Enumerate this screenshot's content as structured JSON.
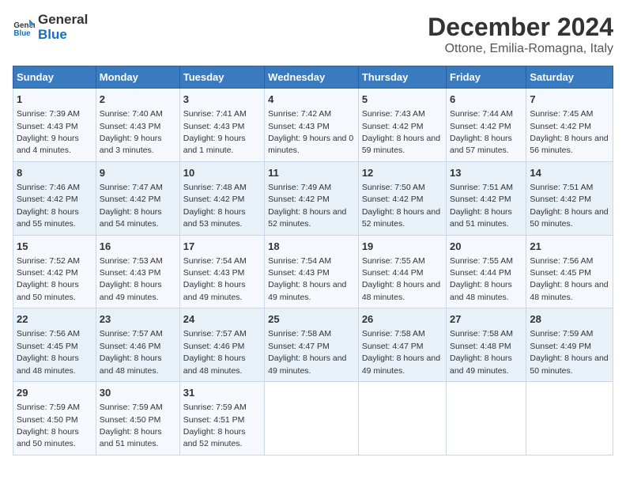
{
  "logo": {
    "text_general": "General",
    "text_blue": "Blue"
  },
  "title": "December 2024",
  "subtitle": "Ottone, Emilia-Romagna, Italy",
  "days_of_week": [
    "Sunday",
    "Monday",
    "Tuesday",
    "Wednesday",
    "Thursday",
    "Friday",
    "Saturday"
  ],
  "weeks": [
    [
      {
        "day": "1",
        "sunrise": "7:39 AM",
        "sunset": "4:43 PM",
        "daylight": "9 hours and 4 minutes."
      },
      {
        "day": "2",
        "sunrise": "7:40 AM",
        "sunset": "4:43 PM",
        "daylight": "9 hours and 3 minutes."
      },
      {
        "day": "3",
        "sunrise": "7:41 AM",
        "sunset": "4:43 PM",
        "daylight": "9 hours and 1 minute."
      },
      {
        "day": "4",
        "sunrise": "7:42 AM",
        "sunset": "4:43 PM",
        "daylight": "9 hours and 0 minutes."
      },
      {
        "day": "5",
        "sunrise": "7:43 AM",
        "sunset": "4:42 PM",
        "daylight": "8 hours and 59 minutes."
      },
      {
        "day": "6",
        "sunrise": "7:44 AM",
        "sunset": "4:42 PM",
        "daylight": "8 hours and 57 minutes."
      },
      {
        "day": "7",
        "sunrise": "7:45 AM",
        "sunset": "4:42 PM",
        "daylight": "8 hours and 56 minutes."
      }
    ],
    [
      {
        "day": "8",
        "sunrise": "7:46 AM",
        "sunset": "4:42 PM",
        "daylight": "8 hours and 55 minutes."
      },
      {
        "day": "9",
        "sunrise": "7:47 AM",
        "sunset": "4:42 PM",
        "daylight": "8 hours and 54 minutes."
      },
      {
        "day": "10",
        "sunrise": "7:48 AM",
        "sunset": "4:42 PM",
        "daylight": "8 hours and 53 minutes."
      },
      {
        "day": "11",
        "sunrise": "7:49 AM",
        "sunset": "4:42 PM",
        "daylight": "8 hours and 52 minutes."
      },
      {
        "day": "12",
        "sunrise": "7:50 AM",
        "sunset": "4:42 PM",
        "daylight": "8 hours and 52 minutes."
      },
      {
        "day": "13",
        "sunrise": "7:51 AM",
        "sunset": "4:42 PM",
        "daylight": "8 hours and 51 minutes."
      },
      {
        "day": "14",
        "sunrise": "7:51 AM",
        "sunset": "4:42 PM",
        "daylight": "8 hours and 50 minutes."
      }
    ],
    [
      {
        "day": "15",
        "sunrise": "7:52 AM",
        "sunset": "4:42 PM",
        "daylight": "8 hours and 50 minutes."
      },
      {
        "day": "16",
        "sunrise": "7:53 AM",
        "sunset": "4:43 PM",
        "daylight": "8 hours and 49 minutes."
      },
      {
        "day": "17",
        "sunrise": "7:54 AM",
        "sunset": "4:43 PM",
        "daylight": "8 hours and 49 minutes."
      },
      {
        "day": "18",
        "sunrise": "7:54 AM",
        "sunset": "4:43 PM",
        "daylight": "8 hours and 49 minutes."
      },
      {
        "day": "19",
        "sunrise": "7:55 AM",
        "sunset": "4:44 PM",
        "daylight": "8 hours and 48 minutes."
      },
      {
        "day": "20",
        "sunrise": "7:55 AM",
        "sunset": "4:44 PM",
        "daylight": "8 hours and 48 minutes."
      },
      {
        "day": "21",
        "sunrise": "7:56 AM",
        "sunset": "4:45 PM",
        "daylight": "8 hours and 48 minutes."
      }
    ],
    [
      {
        "day": "22",
        "sunrise": "7:56 AM",
        "sunset": "4:45 PM",
        "daylight": "8 hours and 48 minutes."
      },
      {
        "day": "23",
        "sunrise": "7:57 AM",
        "sunset": "4:46 PM",
        "daylight": "8 hours and 48 minutes."
      },
      {
        "day": "24",
        "sunrise": "7:57 AM",
        "sunset": "4:46 PM",
        "daylight": "8 hours and 48 minutes."
      },
      {
        "day": "25",
        "sunrise": "7:58 AM",
        "sunset": "4:47 PM",
        "daylight": "8 hours and 49 minutes."
      },
      {
        "day": "26",
        "sunrise": "7:58 AM",
        "sunset": "4:47 PM",
        "daylight": "8 hours and 49 minutes."
      },
      {
        "day": "27",
        "sunrise": "7:58 AM",
        "sunset": "4:48 PM",
        "daylight": "8 hours and 49 minutes."
      },
      {
        "day": "28",
        "sunrise": "7:59 AM",
        "sunset": "4:49 PM",
        "daylight": "8 hours and 50 minutes."
      }
    ],
    [
      {
        "day": "29",
        "sunrise": "7:59 AM",
        "sunset": "4:50 PM",
        "daylight": "8 hours and 50 minutes."
      },
      {
        "day": "30",
        "sunrise": "7:59 AM",
        "sunset": "4:50 PM",
        "daylight": "8 hours and 51 minutes."
      },
      {
        "day": "31",
        "sunrise": "7:59 AM",
        "sunset": "4:51 PM",
        "daylight": "8 hours and 52 minutes."
      },
      null,
      null,
      null,
      null
    ]
  ]
}
